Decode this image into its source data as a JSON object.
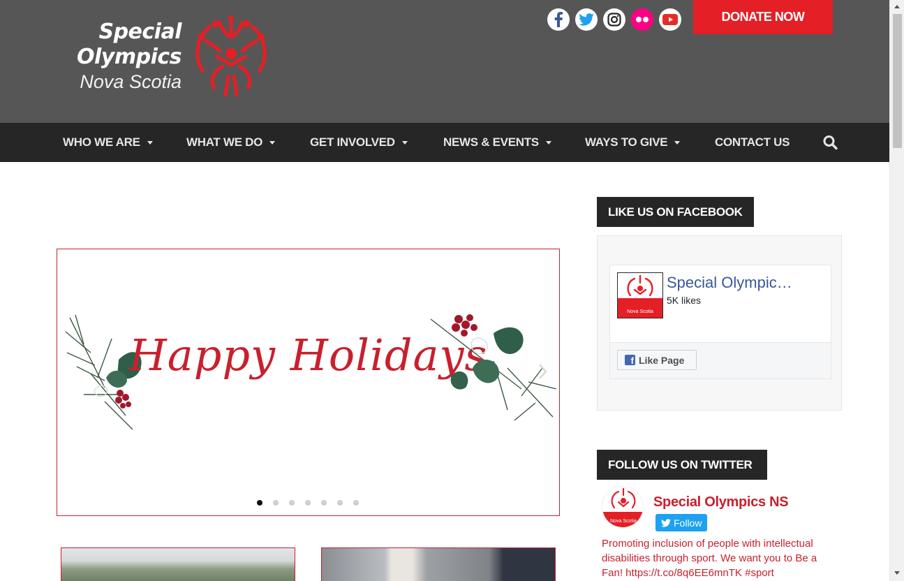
{
  "header": {
    "logo": {
      "line1": "Special",
      "line2": "Olympics",
      "line3": "Nova Scotia"
    },
    "socials": [
      {
        "name": "facebook-icon",
        "color": "#3b5998"
      },
      {
        "name": "twitter-icon",
        "color": "#1da1f2"
      },
      {
        "name": "instagram-icon",
        "color": "#262626"
      },
      {
        "name": "flickr-icon",
        "color": "#ff0084"
      },
      {
        "name": "youtube-icon",
        "color": "#e52d27"
      }
    ],
    "donate_label": "DONATE NOW",
    "brand_red": "#e41f26"
  },
  "nav": {
    "items": [
      {
        "label": "WHO WE ARE",
        "has_dropdown": true
      },
      {
        "label": "WHAT WE DO",
        "has_dropdown": true
      },
      {
        "label": "GET INVOLVED",
        "has_dropdown": true
      },
      {
        "label": "NEWS & EVENTS",
        "has_dropdown": true
      },
      {
        "label": "WAYS TO GIVE",
        "has_dropdown": true
      },
      {
        "label": "CONTACT US",
        "has_dropdown": false
      }
    ],
    "search_icon": "search-icon"
  },
  "slider": {
    "slide_text": "Happy Holidays",
    "slide_count": 7,
    "active_slide": 1
  },
  "sidebar": {
    "facebook": {
      "heading": "LIKE US ON FACEBOOK",
      "page_name": "Special Olympic…",
      "likes": "5K likes",
      "thumb_label": "Nova Scotia",
      "like_button": "Like Page"
    },
    "twitter": {
      "heading": "FOLLOW US ON TWITTER",
      "name": "Special Olympics NS",
      "avatar_label": "Nova Scotia",
      "follow_button": "Follow",
      "bio": "Promoting inclusion of people with intellectual disabilities through sport. We want you to Be a Fan! https://t.co/8q6EE6mnTK #sport"
    }
  }
}
